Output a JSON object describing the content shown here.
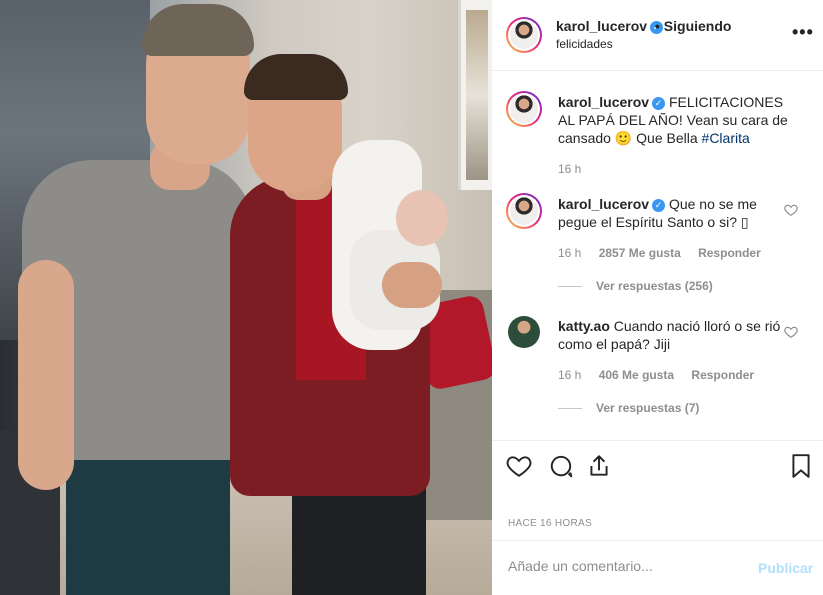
{
  "header": {
    "username": "karol_lucerov",
    "verified_icon": "verified-badge-icon",
    "follow_status": "• Siguiendo",
    "subtitle": "felicidades",
    "more_icon": "more-options-icon"
  },
  "caption": {
    "username": "karol_lucerov",
    "text": "FELICITACIONES AL PAPÁ DEL AÑO! Vean su cara de cansado",
    "emoji": "🙂",
    "text2": "Que Bella",
    "hashtag": "#Clarita",
    "time": "16 h"
  },
  "comments": [
    {
      "username": "karol_lucerov",
      "text": "Que no se me pegue el Espíritu Santo o si? ",
      "glyph": "▯",
      "time": "16 h",
      "likes": "2857 Me gusta",
      "reply_label": "Responder",
      "view_replies": "Ver respuestas (256)"
    },
    {
      "username": "katty.ao",
      "text": "Cuando nació lloró o se rió como el papá? Jiji",
      "time": "16 h",
      "likes": "406 Me gusta",
      "reply_label": "Responder",
      "view_replies": "Ver respuestas (7)"
    }
  ],
  "actions": {
    "like_icon": "heart-icon",
    "comment_icon": "comment-icon",
    "share_icon": "share-icon",
    "save_icon": "bookmark-icon"
  },
  "timestamp": "HACE 16 HORAS",
  "add_comment": {
    "placeholder": "Añade un comentario...",
    "publish_label": "Publicar"
  },
  "colors": {
    "verified": "#3897f0",
    "publish_disabled": "#b2dffc",
    "hashtag": "#003569",
    "meta_grey": "#8e8e8e"
  }
}
